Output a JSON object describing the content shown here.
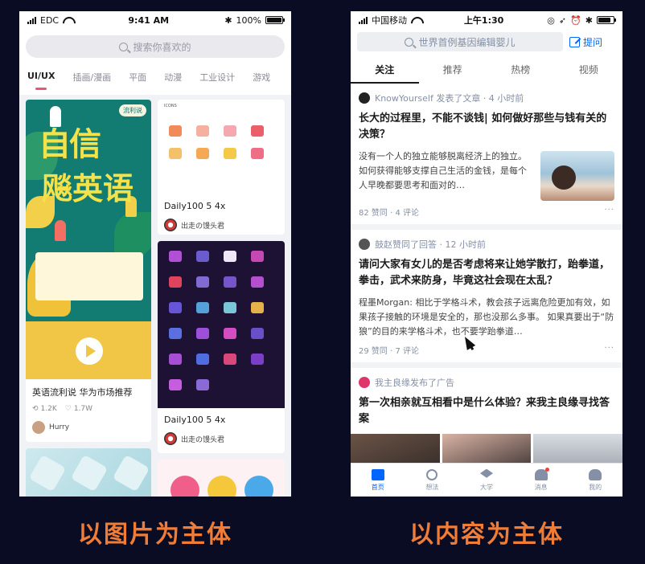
{
  "left_phone": {
    "status": {
      "carrier": "EDC",
      "time": "9:41 AM",
      "battery": "100%"
    },
    "search_placeholder": "搜索你喜欢的",
    "categories": [
      "UI/UX",
      "插画/漫画",
      "平面",
      "动漫",
      "工业设计",
      "游戏"
    ],
    "active_category": "UI/UX",
    "cards": [
      {
        "poster_brand": "流利说",
        "poster_headline_1": "自信",
        "poster_headline_2": "飚英语",
        "title": "英语流利说 华为市场推荐",
        "shares": "1.2K",
        "likes": "1.7W",
        "author": "Hurry"
      },
      {
        "preview_label": "ICONS",
        "title": "Daily100 5 4x",
        "author": "出走の馒头君"
      },
      {
        "title": "Daily100 5 4x",
        "author": "出走の馒头君"
      }
    ]
  },
  "right_phone": {
    "status": {
      "carrier": "中国移动",
      "time": "上午1:30"
    },
    "search_placeholder": "世界首例基因编辑婴儿",
    "ask_label": "提问",
    "tabs": [
      "关注",
      "推荐",
      "热榜",
      "视频"
    ],
    "active_tab": "关注",
    "feed": [
      {
        "meta": "KnowYourself 发表了文章 · 4 小时前",
        "title": "长大的过程里，不能不谈钱| 如何做好那些与钱有关的决策？",
        "excerpt": "没有一个人的独立能够脱离经济上的独立。如何获得能够支撑自己生活的金钱，是每个人早晚都要思考和面对的…",
        "footer": "82 赞同 · 4 评论"
      },
      {
        "meta": "鼓赵赞同了回答 · 12 小时前",
        "title": "请问大家有女儿的是否考虑将来让她学散打，跆拳道，拳击，武术来防身，毕竟这社会现在太乱？",
        "excerpt": "程墨Morgan: 相比于学格斗术，教会孩子远离危险更加有效，如果孩子接触的环境是安全的，那也没那么多事。 如果真要出于“防狼”的目的来学格斗术，也不要学跆拳道…",
        "footer": "29 赞同 · 7 评论"
      },
      {
        "meta": "我主良缘发布了广告",
        "title": "第一次相亲就互相看中是什么体验？来我主良缘寻找答案"
      }
    ],
    "bottom_nav": [
      "首页",
      "想法",
      "大学",
      "消息",
      "我的"
    ],
    "active_nav": "首页"
  },
  "captions": {
    "left": "以图片为主体",
    "right": "以内容为主体"
  },
  "colors": {
    "background": "#0a0c24",
    "caption": "#f07c36",
    "zhihu_blue": "#0066ff",
    "dribbble_pink": "#e8557a"
  }
}
